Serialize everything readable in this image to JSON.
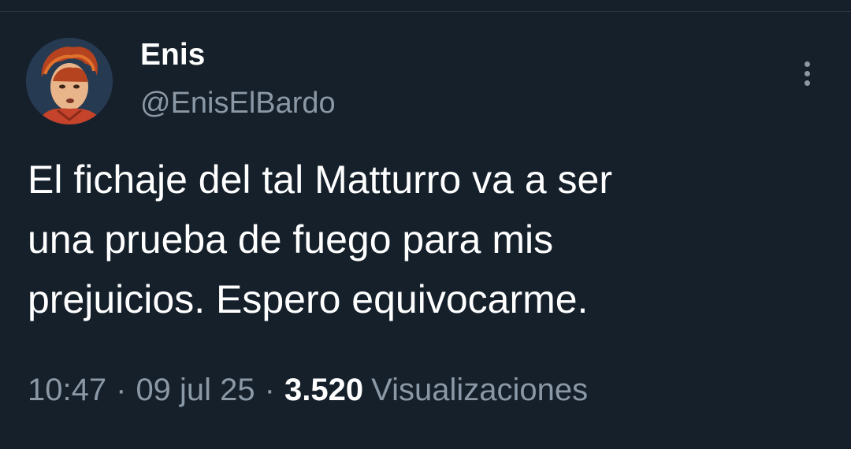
{
  "tweet": {
    "author": {
      "display_name": "Enis",
      "handle": "@EnisElBardo"
    },
    "text_lines": [
      "El fichaje del tal Matturro va a ser",
      "una prueba de fuego para mis",
      "prejuicios. Espero equivocarme."
    ],
    "time": "10:47",
    "date": "09 jul 25",
    "separator": "·",
    "views_count": "3.520",
    "views_label": "Visualizaciones",
    "more_icon": "more-vertical-icon"
  },
  "colors": {
    "background": "#15202b",
    "primary_text": "#ffffff",
    "secondary_text": "#8b98a5"
  }
}
